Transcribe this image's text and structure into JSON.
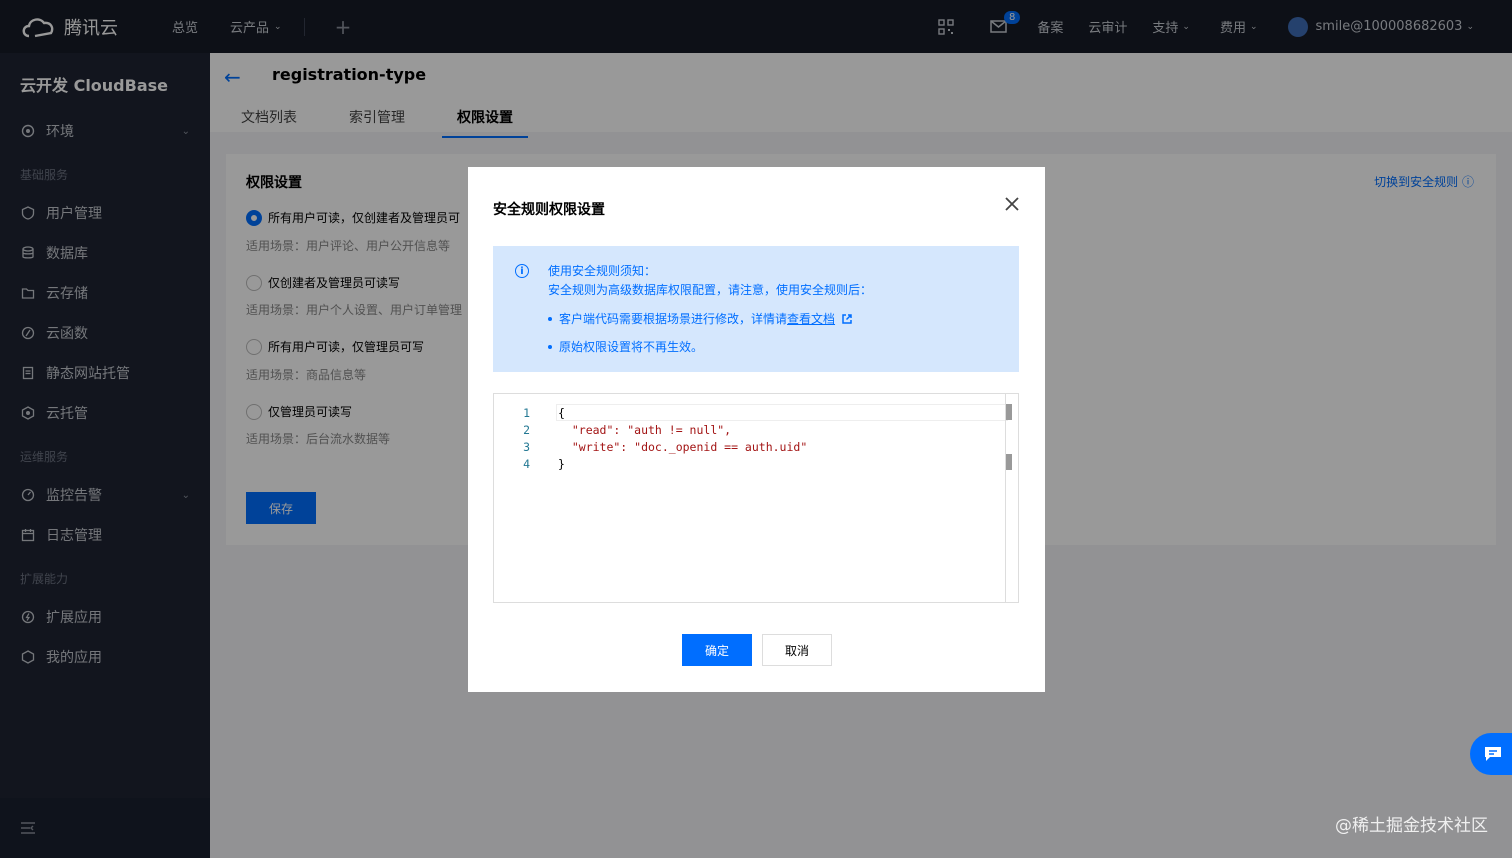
{
  "topnav": {
    "brand": "腾讯云",
    "overview": "总览",
    "products": "云产品",
    "beian": "备案",
    "audit": "云审计",
    "support": "支持",
    "billing": "费用",
    "user": "smile@100008682603",
    "mail_count": "8"
  },
  "sidebar": {
    "title": "云开发 CloudBase",
    "env": "环境",
    "group_basic": "基础服务",
    "items_basic": [
      "用户管理",
      "数据库",
      "云存储",
      "云函数",
      "静态网站托管",
      "云托管"
    ],
    "group_ops": "运维服务",
    "items_ops": [
      "监控告警",
      "日志管理"
    ],
    "group_ext": "扩展能力",
    "items_ext": [
      "扩展应用",
      "我的应用"
    ]
  },
  "page": {
    "title": "registration-type",
    "tabs": [
      "文档列表",
      "索引管理",
      "权限设置"
    ],
    "card_title": "权限设置",
    "switch_link": "切换到安全规则",
    "options": [
      {
        "label": "所有用户可读，仅创建者及管理员可",
        "sub": "适用场景：用户评论、用户公开信息等"
      },
      {
        "label": "仅创建者及管理员可读写",
        "sub": "适用场景：用户个人设置、用户订单管理"
      },
      {
        "label": "所有用户可读，仅管理员可写",
        "sub": "适用场景：商品信息等"
      },
      {
        "label": "仅管理员可读写",
        "sub": "适用场景：后台流水数据等"
      }
    ],
    "save": "保存"
  },
  "dialog": {
    "title": "安全规则权限设置",
    "notice_title": "使用安全规则须知：",
    "notice_desc": "安全规则为高级数据库权限配置，请注意，使用安全规则后：",
    "bullet1_prefix": "客户端代码需要根据场景进行修改，详情请",
    "bullet1_link": "查看文档",
    "bullet2": "原始权限设置将不再生效。",
    "code_lines": [
      "{",
      "  \"read\": \"auth != null\",",
      "  \"write\": \"doc._openid == auth.uid\"",
      "}"
    ],
    "ok": "确定",
    "cancel": "取消"
  },
  "watermark": "@稀土掘金技术社区"
}
